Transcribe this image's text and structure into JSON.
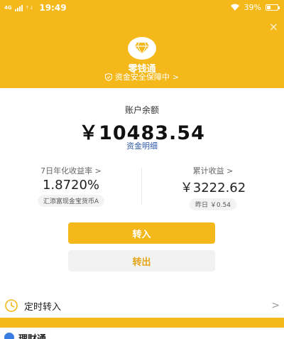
{
  "status_bar": {
    "network": "4G",
    "time": "19:49",
    "battery": "39%",
    "battery_level": 0.39
  },
  "header": {
    "title": "零钱通",
    "security": "资金安全保障中",
    "security_arrow": ">",
    "close": "×",
    "brand_color": "#f4b81a"
  },
  "balance": {
    "label": "账户余额",
    "value": "￥10483.54",
    "detail_link": "资金明细"
  },
  "stats": {
    "yield_label": "7日年化收益率 >",
    "yield_value": "1.8720%",
    "fund_name": "汇添富现金宝货币A",
    "earnings_label": "累计收益 >",
    "earnings_value": "￥3222.62",
    "yesterday": "昨日 ￥0.54"
  },
  "actions": {
    "transfer_in": "转入",
    "transfer_out": "转出"
  },
  "timed_transfer": {
    "label": "定时转入",
    "arrow": ">"
  },
  "bottom": {
    "partial_text": "理财通"
  }
}
